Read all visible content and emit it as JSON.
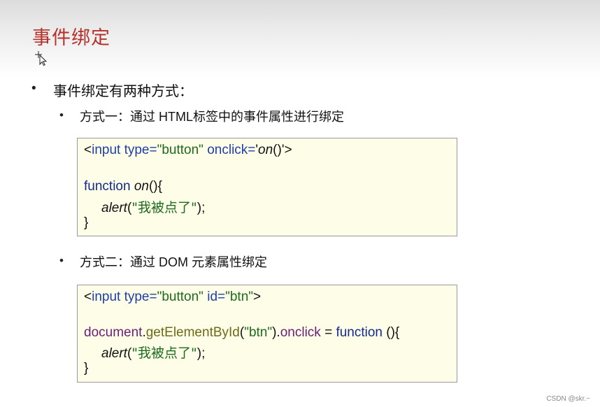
{
  "slide": {
    "title": "事件绑定",
    "bullet_char": "•",
    "intro": "事件绑定有两种方式：",
    "method1": "方式一：通过 HTML标签中的事件属性进行绑定",
    "method2": "方式二：通过 DOM 元素属性绑定"
  },
  "code1": {
    "l1_open": "<",
    "l1_tag": "input",
    "l1_attr1": " type=",
    "l1_val1": "\"button\"",
    "l1_attr2": " onclick=",
    "l1_q": "'",
    "l1_fn": "on",
    "l1_paren": "()",
    "l1_close": "'>",
    "l2_kw": "function",
    "l2_name": " on",
    "l2_rest": "(){",
    "l3_fn": "alert",
    "l3_p1": "(",
    "l3_str": "\"我被点了\"",
    "l3_p2": ");",
    "l4": "}"
  },
  "code2": {
    "l1_open": "<",
    "l1_tag": "input",
    "l1_attr1": " type=",
    "l1_val1": "\"button\"",
    "l1_attr2": " id=",
    "l1_val2": "\"btn\"",
    "l1_close": ">",
    "l2_obj": "document",
    "l2_dot": ".",
    "l2_method": "getElementById",
    "l2_p1": "(",
    "l2_arg": "\"btn\"",
    "l2_p2": ").",
    "l2_prop": "onclick",
    "l2_eq": " = ",
    "l2_kw": "function",
    "l2_rest": " (){",
    "l3_fn": "alert",
    "l3_p1": "(",
    "l3_str": "\"我被点了\"",
    "l3_p2": ");",
    "l4": "}"
  },
  "watermark": "CSDN @skr.~"
}
